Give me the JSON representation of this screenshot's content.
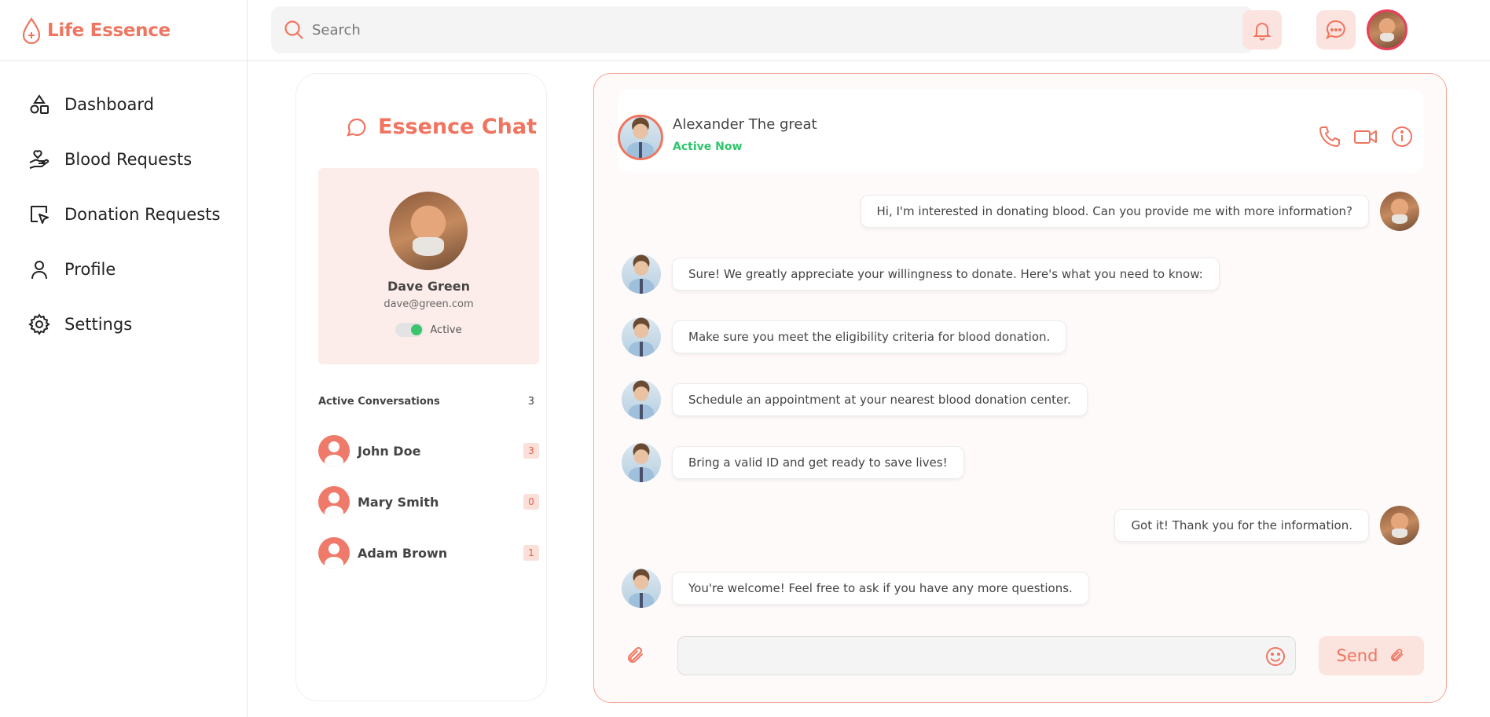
{
  "app": {
    "name": "Life Essence"
  },
  "sidebar": {
    "items": [
      {
        "label": "Dashboard",
        "icon": "shapes-icon"
      },
      {
        "label": "Blood Requests",
        "icon": "hand-heart-icon"
      },
      {
        "label": "Donation Requests",
        "icon": "cursor-square-icon"
      },
      {
        "label": "Profile",
        "icon": "user-icon"
      },
      {
        "label": "Settings",
        "icon": "gear-icon"
      }
    ]
  },
  "topbar": {
    "search_placeholder": "Search"
  },
  "chat_list": {
    "title": "Essence Chat",
    "profile": {
      "name": "Dave Green",
      "email": "dave@green.com",
      "status": "Active"
    },
    "conversations_title": "Active Conversations",
    "conversations_count": "3",
    "conversations": [
      {
        "name": "John Doe",
        "unread": "3"
      },
      {
        "name": "Mary Smith",
        "unread": "0"
      },
      {
        "name": "Adam Brown",
        "unread": "1"
      }
    ]
  },
  "chat": {
    "contact_name": "Alexander The great",
    "contact_status": "Active Now",
    "messages": [
      {
        "from": "me",
        "text": "Hi, I'm interested in donating blood. Can you provide me with more information?"
      },
      {
        "from": "them",
        "text": "Sure! We greatly appreciate your willingness to donate. Here's what you need to know:"
      },
      {
        "from": "them",
        "text": "Make sure you meet the eligibility criteria for blood donation."
      },
      {
        "from": "them",
        "text": "Schedule an appointment at your nearest blood donation center."
      },
      {
        "from": "them",
        "text": "Bring a valid ID and get ready to save lives!"
      },
      {
        "from": "me",
        "text": "Got it! Thank you for the information."
      },
      {
        "from": "them",
        "text": "You're welcome! Feel free to ask if you have any more questions."
      }
    ],
    "input_placeholder": "",
    "send_label": "Send"
  },
  "colors": {
    "accent": "#ef7560",
    "active": "#2dc46a",
    "badge_bg": "#fbe0da"
  }
}
